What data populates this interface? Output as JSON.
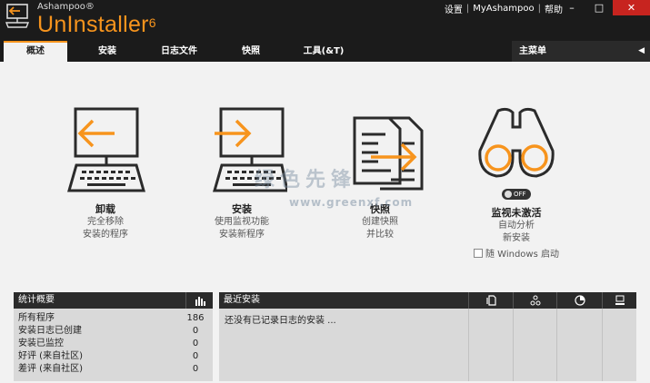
{
  "app": {
    "brand_small": "Ashampoo®",
    "brand_name": "UnInstaller",
    "brand_version": "6"
  },
  "toplinks": {
    "settings": "设置",
    "sep1": "|",
    "myashampoo": "MyAshampoo",
    "sep2": "|",
    "help": "帮助"
  },
  "window_buttons": {
    "minimize": "–",
    "maximize": "□",
    "close": "✕"
  },
  "tabs": [
    {
      "label": "概述",
      "active": true
    },
    {
      "label": "安装",
      "active": false
    },
    {
      "label": "日志文件",
      "active": false
    },
    {
      "label": "快照",
      "active": false
    },
    {
      "label": "工具(&T)",
      "active": false
    }
  ],
  "main_menu": {
    "label": "主菜单",
    "arrow": "◀"
  },
  "features": [
    {
      "title": "卸载",
      "lines": [
        "完全移除",
        "安装的程序"
      ],
      "icon": "monitor-arrow-left-icon"
    },
    {
      "title": "安装",
      "lines": [
        "使用监视功能",
        "安装新程序"
      ],
      "icon": "monitor-arrow-right-icon"
    },
    {
      "title": "快照",
      "lines": [
        "创建快照",
        "并比较"
      ],
      "icon": "documents-arrow-icon"
    },
    {
      "title": "监视未激活",
      "lines": [
        "自动分析",
        "新安装"
      ],
      "icon": "binoculars-icon",
      "toggle": "OFF",
      "checkbox_label": "随 Windows 启动"
    }
  ],
  "watermark": {
    "main": "绿色先锋",
    "url": "www.greenxf.com"
  },
  "stats": {
    "title": "统计概要",
    "rows": [
      {
        "label": "所有程序",
        "value": "186"
      },
      {
        "label": "安装日志已创建",
        "value": "0"
      },
      {
        "label": "安装已监控",
        "value": "0"
      },
      {
        "label": "好评 (来自社区)",
        "value": "0"
      },
      {
        "label": "差评 (来自社区)",
        "value": "0"
      }
    ]
  },
  "recent": {
    "title": "最近安装",
    "empty_text": "还没有已记录日志的安装 ...",
    "column_icons": [
      "document-icon",
      "network-icon",
      "pie-chart-icon",
      "computer-icon"
    ]
  },
  "colors": {
    "accent": "#f7941d",
    "titlebar": "#1b1b1b",
    "close": "#c7241f"
  }
}
